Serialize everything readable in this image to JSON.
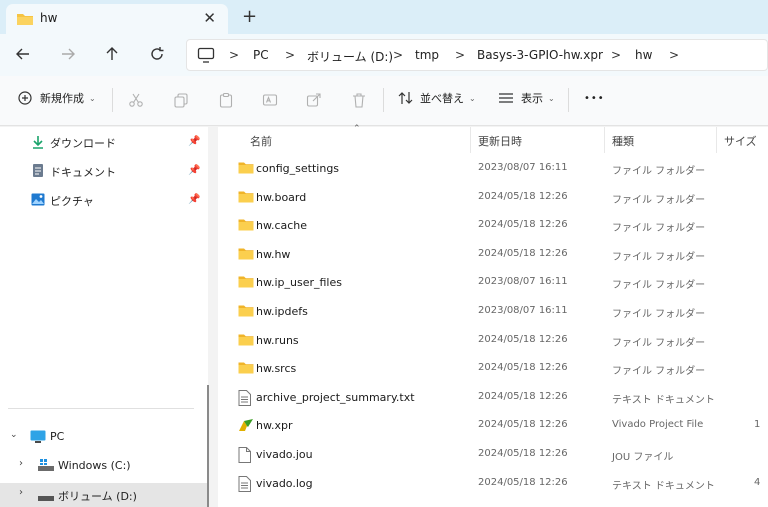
{
  "tab": {
    "title": "hw",
    "close": "✕",
    "new_tab": "+"
  },
  "breadcrumb": [
    {
      "label": "PC"
    },
    {
      "label": "ボリューム (D:)"
    },
    {
      "label": "tmp"
    },
    {
      "label": "Basys-3-GPIO-hw.xpr"
    },
    {
      "label": "hw"
    }
  ],
  "breadcrumb_separator": ">",
  "toolbar": {
    "new_label": "新規作成",
    "sort_label": "並べ替え",
    "view_label": "表示",
    "more_label": "•••"
  },
  "sidebar": {
    "quick_access": [
      {
        "label": "ダウンロード",
        "icon": "download-icon",
        "pinned": true
      },
      {
        "label": "ドキュメント",
        "icon": "document-icon",
        "pinned": true
      },
      {
        "label": "ピクチャ",
        "icon": "picture-icon",
        "pinned": true
      }
    ],
    "this_pc": {
      "label": "PC",
      "expanded": true
    },
    "drives": [
      {
        "label": "Windows (C:)",
        "icon": "windows-drive-icon",
        "selected": false
      },
      {
        "label": "ボリューム (D:)",
        "icon": "drive-icon",
        "selected": true
      }
    ]
  },
  "columns": {
    "name": "名前",
    "date": "更新日時",
    "type": "種類",
    "size": "サイズ"
  },
  "files": [
    {
      "name": "config_settings",
      "date": "2023/08/07 16:11",
      "type": "ファイル フォルダー",
      "size": "",
      "icon": "folder-icon"
    },
    {
      "name": "hw.board",
      "date": "2024/05/18 12:26",
      "type": "ファイル フォルダー",
      "size": "",
      "icon": "folder-icon"
    },
    {
      "name": "hw.cache",
      "date": "2024/05/18 12:26",
      "type": "ファイル フォルダー",
      "size": "",
      "icon": "folder-icon"
    },
    {
      "name": "hw.hw",
      "date": "2024/05/18 12:26",
      "type": "ファイル フォルダー",
      "size": "",
      "icon": "folder-icon"
    },
    {
      "name": "hw.ip_user_files",
      "date": "2023/08/07 16:11",
      "type": "ファイル フォルダー",
      "size": "",
      "icon": "folder-icon"
    },
    {
      "name": "hw.ipdefs",
      "date": "2023/08/07 16:11",
      "type": "ファイル フォルダー",
      "size": "",
      "icon": "folder-icon"
    },
    {
      "name": "hw.runs",
      "date": "2024/05/18 12:26",
      "type": "ファイル フォルダー",
      "size": "",
      "icon": "folder-icon"
    },
    {
      "name": "hw.srcs",
      "date": "2024/05/18 12:26",
      "type": "ファイル フォルダー",
      "size": "",
      "icon": "folder-icon"
    },
    {
      "name": "archive_project_summary.txt",
      "date": "2024/05/18 12:26",
      "type": "テキスト ドキュメント",
      "size": "",
      "icon": "text-file-icon"
    },
    {
      "name": "hw.xpr",
      "date": "2024/05/18 12:26",
      "type": "Vivado Project File",
      "size": "1",
      "icon": "vivado-icon"
    },
    {
      "name": "vivado.jou",
      "date": "2024/05/18 12:26",
      "type": "JOU ファイル",
      "size": "",
      "icon": "file-icon"
    },
    {
      "name": "vivado.log",
      "date": "2024/05/18 12:26",
      "type": "テキスト ドキュメント",
      "size": "4",
      "icon": "text-file-icon"
    }
  ],
  "colors": {
    "tab_bar": "#dbeef8",
    "folder": "#f6c443",
    "accent": "#0078d4",
    "selection": "#e5e5e5"
  }
}
